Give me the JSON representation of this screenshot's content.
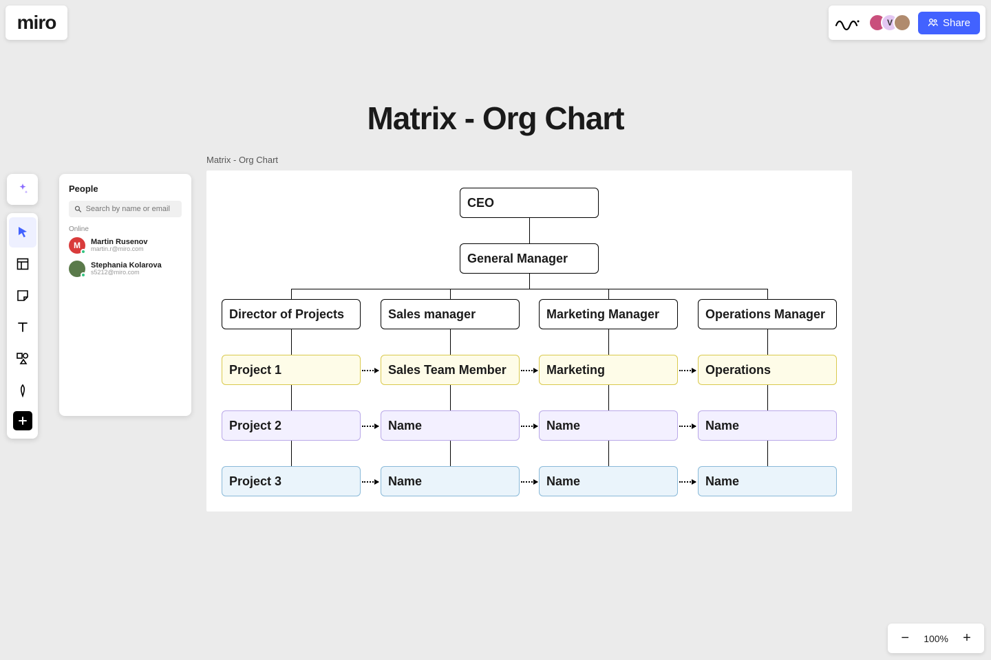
{
  "app": {
    "logo": "miro"
  },
  "header": {
    "share_label": "Share",
    "avatars": [
      {
        "initial": "",
        "bg": "#c94f7c"
      },
      {
        "initial": "V",
        "bg": "#e3c7f2"
      },
      {
        "initial": "",
        "bg": "#b08b6e"
      }
    ]
  },
  "people_panel": {
    "title": "People",
    "search_placeholder": "Search by name or email",
    "status_label": "Online",
    "people": [
      {
        "name": "Martin Rusenov",
        "email": "martin.r@miro.com",
        "initial": "M",
        "bg": "#d93b3b"
      },
      {
        "name": "Stephania Kolarova",
        "email": "s5212@miro.com",
        "initial": "",
        "bg": "#5a7a4a"
      }
    ]
  },
  "canvas": {
    "title": "Matrix - Org Chart",
    "frame_label": "Matrix - Org Chart"
  },
  "chart_data": {
    "type": "org-matrix",
    "top": [
      {
        "id": "ceo",
        "label": "CEO"
      },
      {
        "id": "gm",
        "label": "General Manager"
      }
    ],
    "managers": [
      {
        "id": "dir",
        "label": "Director of Projects"
      },
      {
        "id": "sales_mgr",
        "label": "Sales manager"
      },
      {
        "id": "mkt_mgr",
        "label": "Marketing Manager"
      },
      {
        "id": "ops_mgr",
        "label": "Operations Manager"
      }
    ],
    "rows": [
      {
        "color": "yellow",
        "cells": [
          "Project 1",
          "Sales Team Member",
          "Marketing",
          "Operations"
        ]
      },
      {
        "color": "purple",
        "cells": [
          "Project 2",
          "Name",
          "Name",
          "Name"
        ]
      },
      {
        "color": "blue",
        "cells": [
          "Project 3",
          "Name",
          "Name",
          "Name"
        ]
      }
    ]
  },
  "zoom": {
    "value": "100%"
  }
}
